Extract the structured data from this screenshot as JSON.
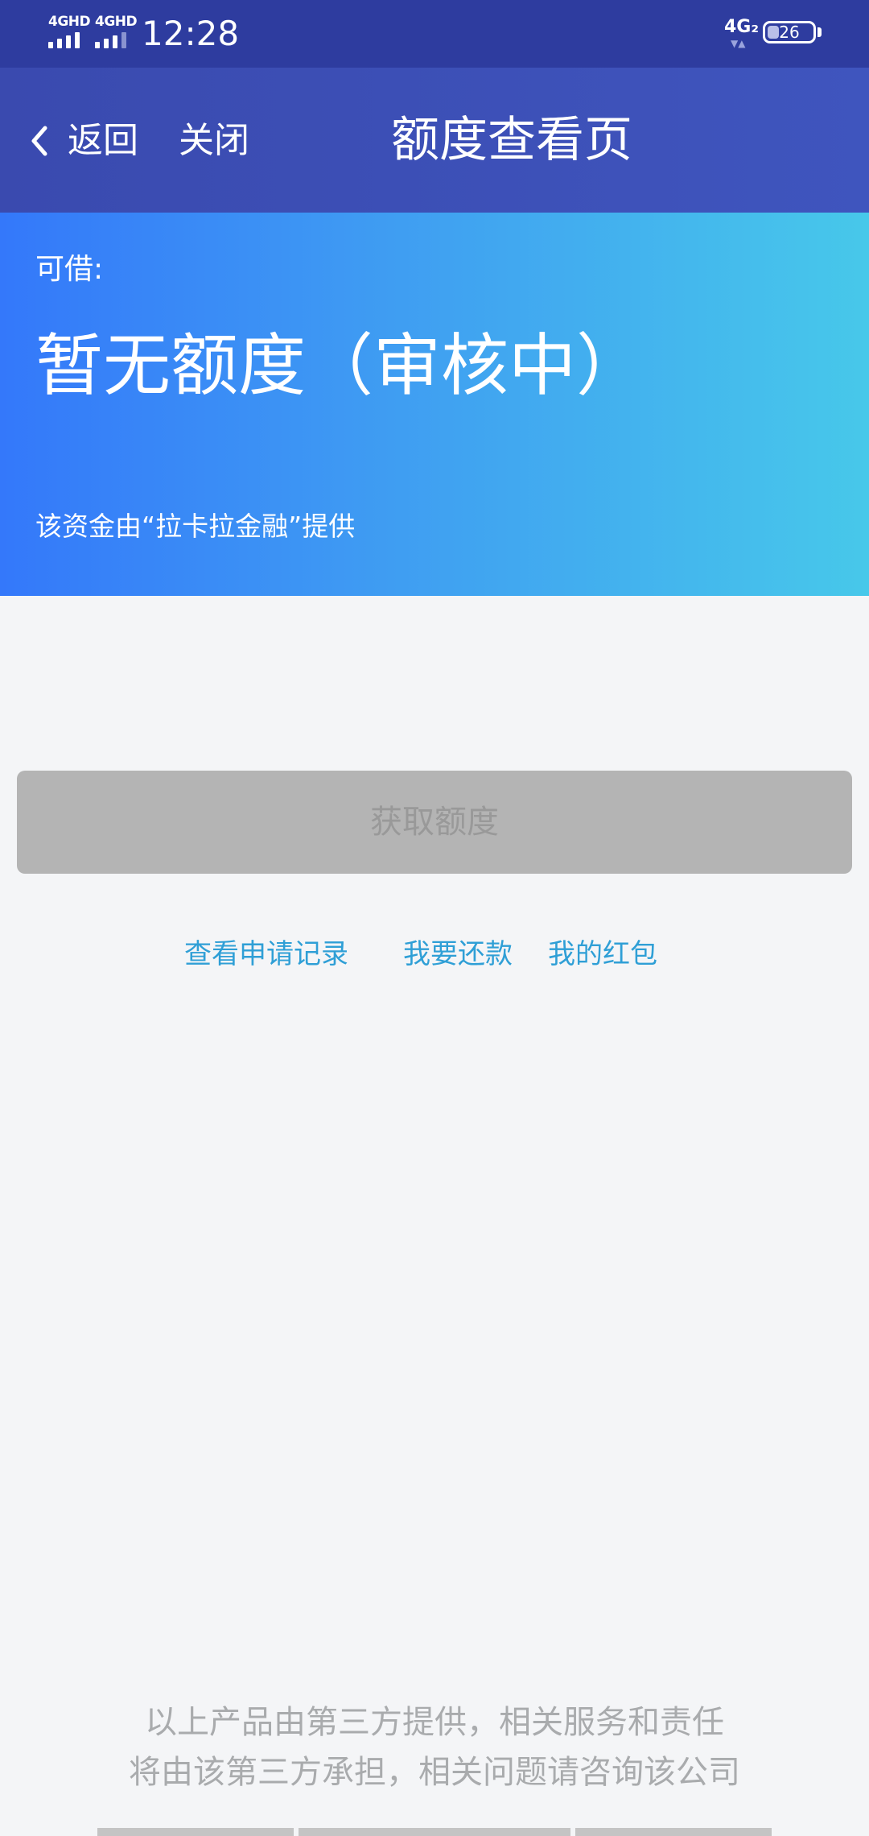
{
  "status_bar": {
    "network_left_1": "4GHD",
    "network_left_2": "4GHD",
    "time": "12:28",
    "network_right": "4G₂",
    "battery_level": "26"
  },
  "nav": {
    "back_label": "返回",
    "close_label": "关闭",
    "title": "额度查看页"
  },
  "hero": {
    "label": "可借:",
    "amount_status": "暂无额度（审核中）",
    "provider_note": "该资金由“拉卡拉金融”提供"
  },
  "actions": {
    "get_quota_label": "获取额度",
    "links": {
      "records": "查看申请记录",
      "repay": "我要还款",
      "red_packet": "我的红包"
    }
  },
  "disclaimer": {
    "line1": "以上产品由第三方提供，相关服务和责任",
    "line2": "将由该第三方承担，相关问题请咨询该公司"
  },
  "colors": {
    "status_bar_bg": "#2e3c9f",
    "nav_bg": "#3f55be",
    "hero_gradient_start": "#3478fa",
    "hero_gradient_end": "#47c8ea",
    "link": "#2f9fd6",
    "disabled_button": "#b4b4b4"
  }
}
